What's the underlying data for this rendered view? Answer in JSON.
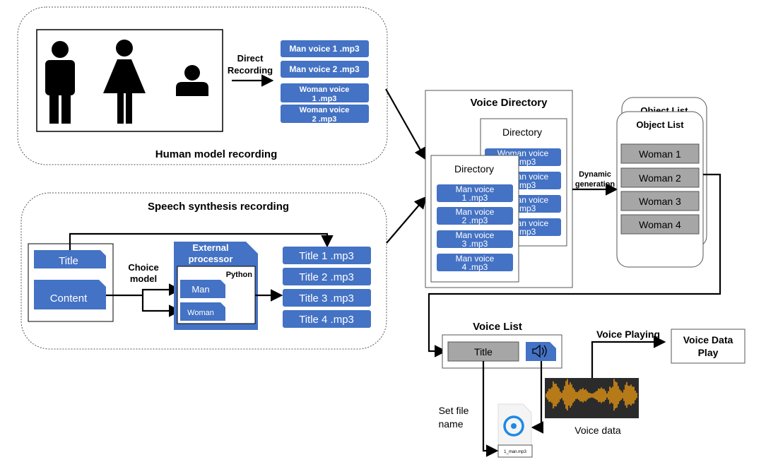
{
  "colors": {
    "file_blue": "#4472c4",
    "list_gray": "#a6a6a6",
    "waveform": "#f39c12",
    "waveform_bg": "#2b2b2b"
  },
  "human": {
    "title": "Human model recording",
    "direct_1": "Direct",
    "direct_2": "Recording",
    "files": [
      [
        "Man voice 1 .mp3"
      ],
      [
        "Man voice 2 .mp3"
      ],
      [
        "Woman voice",
        "1 .mp3"
      ],
      [
        "Woman voice",
        "2 .mp3"
      ]
    ],
    "icons": [
      "man-figure-icon",
      "woman-figure-icon",
      "person-bust-icon"
    ]
  },
  "synth": {
    "title": "Speech synthesis recording",
    "input_title": "Title",
    "input_content": "Content",
    "choice_1": "Choice",
    "choice_2": "model",
    "ext_1": "External",
    "ext_2": "processor",
    "python": "Python",
    "man": "Man",
    "woman": "Woman",
    "files": [
      "Title  1 .mp3",
      "Title  2 .mp3",
      "Title  3 .mp3",
      "Title  4 .mp3"
    ]
  },
  "directory": {
    "title": "Voice Directory",
    "dir_label": "Directory",
    "woman_files": [
      [
        "Woman voice",
        "1 .mp3"
      ],
      [
        "Woman voice",
        "2 .mp3"
      ],
      [
        "Woman voice",
        "3 .mp3"
      ],
      [
        "Woman voice",
        "4 .mp3"
      ]
    ],
    "man_files": [
      [
        "Man voice",
        "1 .mp3"
      ],
      [
        "Man voice",
        "2 .mp3"
      ],
      [
        "Man voice",
        "3 .mp3"
      ],
      [
        "Man voice",
        "4 .mp3"
      ]
    ]
  },
  "dynamic_1": "Dynamic",
  "dynamic_2": "generation",
  "object_list": {
    "title": "Object List",
    "items": [
      "Woman 1",
      "Woman 2",
      "Woman 3",
      "Woman 4"
    ]
  },
  "voice_list": {
    "title": "Voice List",
    "item_title": "Title",
    "speaker_icon": "speaker-icon"
  },
  "set_file_1": "Set file",
  "set_file_2": "name",
  "file_name": "1_man.mp3",
  "voice_data": "Voice data",
  "voice_playing": "Voice Playing",
  "play_1": "Voice Data",
  "play_2": "Play"
}
